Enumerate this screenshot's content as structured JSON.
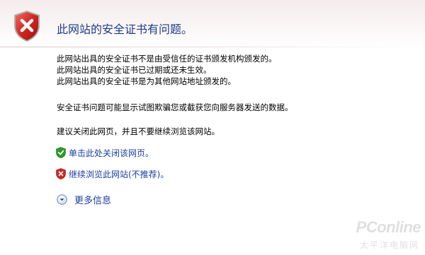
{
  "title": "此网站的安全证书有问题。",
  "reasons": [
    "此网站出具的安全证书不是由受信任的证书颁发机构颁发的。",
    "此网站出具的安全证书已过期或还未生效。",
    "此网站出具的安全证书是为其他网站地址颁发的。"
  ],
  "risk": "安全证书问题可能显示试图欺骗您或截获您向服务器发送的数据。",
  "advice": "建议关闭此网页，并且不要继续浏览该网站。",
  "options": {
    "close": "单击此处关闭该网页。",
    "continue": "继续浏览此网站(不推荐)。"
  },
  "more_info": "更多信息",
  "watermark": {
    "logo": "PConline",
    "sub": "太平洋电脑网"
  },
  "colors": {
    "link": "#1b3fa0",
    "title": "#1f3c8a",
    "shield_red": "#c8191c"
  }
}
